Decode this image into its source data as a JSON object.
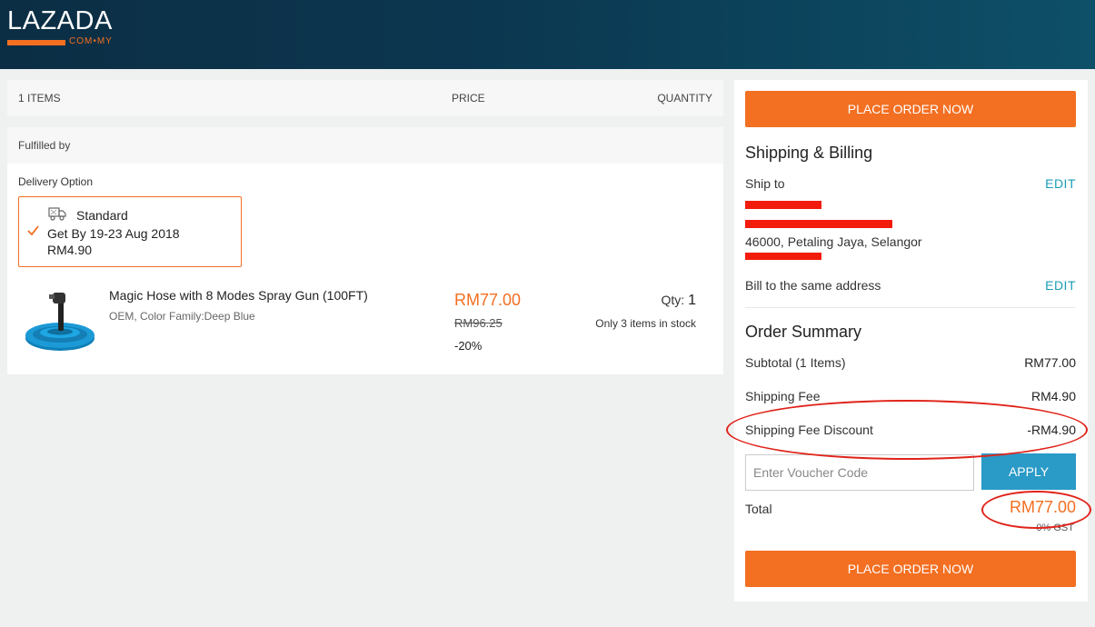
{
  "header": {
    "logo_text": "LAZADA",
    "logo_domain": "COM•MY",
    "brand_color": "#f36f21"
  },
  "cart": {
    "items_label": "1 ITEMS",
    "price_header": "PRICE",
    "quantity_header": "QUANTITY",
    "fulfilled_by": "Fulfilled by",
    "delivery_option_label": "Delivery Option",
    "delivery": {
      "name": "Standard",
      "eta": "Get By 19-23 Aug 2018",
      "price": "RM4.90",
      "icon": "truck-icon"
    },
    "product": {
      "name": "Magic Hose with 8 Modes Spray Gun (100FT)",
      "variant": "OEM, Color Family:Deep Blue",
      "price_now": "RM77.00",
      "price_old": "RM96.25",
      "discount": "-20%",
      "qty_label": "Qty:",
      "qty_value": "1",
      "stock_note": "Only 3 items in stock"
    }
  },
  "summary": {
    "place_order_label": "PLACE ORDER NOW",
    "shipping_billing_title": "Shipping & Billing",
    "ship_to_label": "Ship to",
    "edit_label": "EDIT",
    "address_city": "46000, Petaling Jaya, Selangor",
    "bill_same_label": "Bill to the same address",
    "order_summary_title": "Order Summary",
    "subtotal_label": "Subtotal (1 Items)",
    "subtotal_value": "RM77.00",
    "shipping_fee_label": "Shipping Fee",
    "shipping_fee_value": "RM4.90",
    "shipping_discount_label": "Shipping Fee Discount",
    "shipping_discount_value": "-RM4.90",
    "voucher_placeholder": "Enter Voucher Code",
    "apply_label": "APPLY",
    "total_label": "Total",
    "total_value": "RM77.00",
    "gst_note": "0% GST"
  }
}
